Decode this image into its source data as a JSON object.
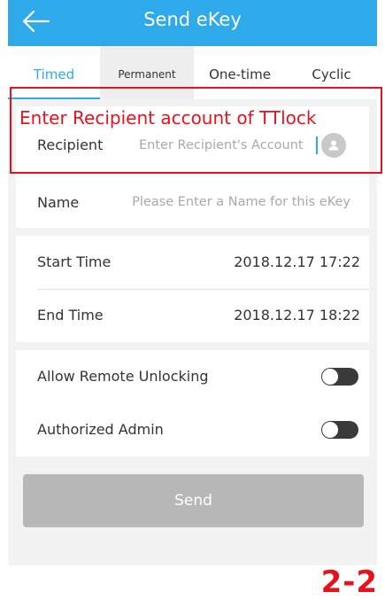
{
  "header": {
    "title": "Send eKey",
    "back_icon": "arrow-left-icon"
  },
  "tabs": [
    {
      "label": "Timed",
      "active": true
    },
    {
      "label": "Permanent",
      "active": false
    },
    {
      "label": "One-time",
      "active": false
    },
    {
      "label": "Cyclic",
      "active": false
    }
  ],
  "recipient": {
    "label": "Recipient",
    "placeholder": "Enter Recipient's Account",
    "value": "",
    "icon": "contact-icon"
  },
  "name": {
    "label": "Name",
    "placeholder": "Please Enter a Name for this eKey",
    "value": ""
  },
  "times": {
    "start_label": "Start Time",
    "start_value": "2018.12.17 17:22",
    "end_label": "End Time",
    "end_value": "2018.12.17 18:22"
  },
  "options": {
    "remote_unlock_label": "Allow Remote Unlocking",
    "remote_unlock_on": false,
    "admin_label": "Authorized Admin",
    "admin_on": false
  },
  "send_label": "Send",
  "annotation": {
    "note": "Enter Recipient account of TTlock",
    "step": "2-2",
    "color": "#e8121b"
  },
  "colors": {
    "accent": "#2eaaea",
    "button_disabled": "#b7b7b7",
    "toggle_off": "#3a3a3a"
  }
}
